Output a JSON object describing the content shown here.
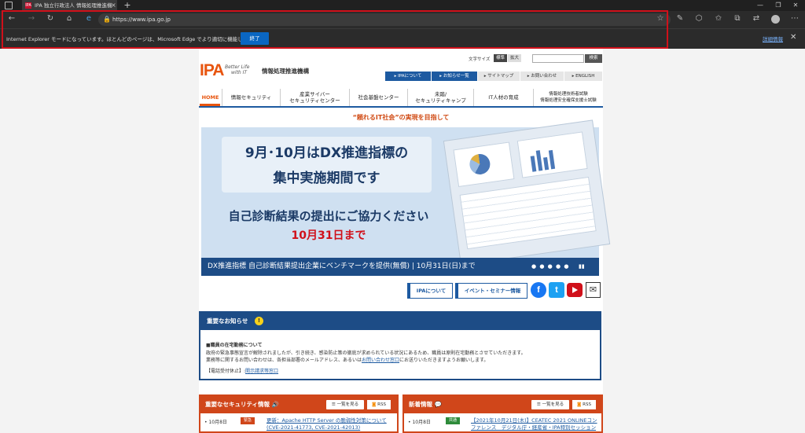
{
  "browser": {
    "tab_title": "IPA 独立行政法人 情報処理推進機",
    "tab_favicon": "IPA",
    "new_tab": "+",
    "url": "https://www.ipa.go.jp",
    "ie_message": "Internet Explorer モードになっています。ほとんどのページは、Microsoft Edge でより適切に機能します。",
    "ie_button": "終了",
    "ie_more": "詳細情報"
  },
  "site": {
    "logo": "IPA",
    "logo_tagline_1": "Better Life",
    "logo_tagline_2": "with IT",
    "org_name": "情報処理推進機構",
    "font_size_label": "文字サイズ",
    "font_std": "標準",
    "font_big": "拡大",
    "search_button": "検索",
    "utility_nav": [
      "IPAについて",
      "お知らせ一覧",
      "サイトマップ",
      "お問い合わせ",
      "ENGLISH"
    ],
    "global_nav": {
      "home": "HOME",
      "security": "情報セキュリティ",
      "cyber_1": "産業サイバー",
      "cyber_2": "セキュリティセンター",
      "social": "社会基盤センター",
      "future_1": "未踏/",
      "future_2": "セキュリティキャンプ",
      "hr": "IT人材の育成",
      "exam_1": "情報処理技術者試験",
      "exam_2": "情報処理安全確保支援士試験"
    },
    "tagline": "“頼れるIT社会”の実現を目指して"
  },
  "hero": {
    "title_1": "9月･10月はDX推進指標の",
    "title_2": "集中実施期間です",
    "subtitle": "自己診断結果の提出にご協力ください",
    "deadline": "10月31日まで",
    "caption": "DX推進指標 自己診断結果提出企業にベンチマークを提供(無償) | 10月31日(日)まで",
    "dots": "● ● ● ● ●",
    "play_pause": "▮▮"
  },
  "quick_links": [
    "IPAについて",
    "イベント・セミナー情報"
  ],
  "notice": {
    "heading": "重要なお知らせ",
    "icon": "!",
    "title": "■職員の在宅勤務について",
    "line1": "政府の緊急事態宣言が解除されましたが、引き続き、感染防止策の徹底が求められている状況にあるため、職員は原則在宅勤務とさせていただきます。",
    "line2_pre": "業務等に関するお問い合わせは、各担当部署のメールアドレス、あるいは",
    "line2_link": "お問い合わせ窓口",
    "line2_post": "にお送りいただきますようお願いします。",
    "line3_pre": "【電話受付休止】:",
    "line3_link": "開示請求等窓口"
  },
  "security_box": {
    "heading": "重要なセキュリティ情報",
    "list_button": "一覧を見る",
    "rss": "RSS",
    "date": "• 10月8日",
    "badge": "緊急",
    "link_1": "更新：Apache HTTP Server の脆弱性対策について",
    "link_2": "(CVE-2021-41773, CVE-2021-42013)"
  },
  "news_box": {
    "heading": "新着情報",
    "list_button": "一覧を見る",
    "rss": "RSS",
    "date": "• 10月8日",
    "badge": "共通",
    "link_1": "【2021年10月21日(木)】CEATEC 2021 ONLINEコン",
    "link_2": "ファレンス　デジタル庁・経産省・IPA特別セッション"
  }
}
